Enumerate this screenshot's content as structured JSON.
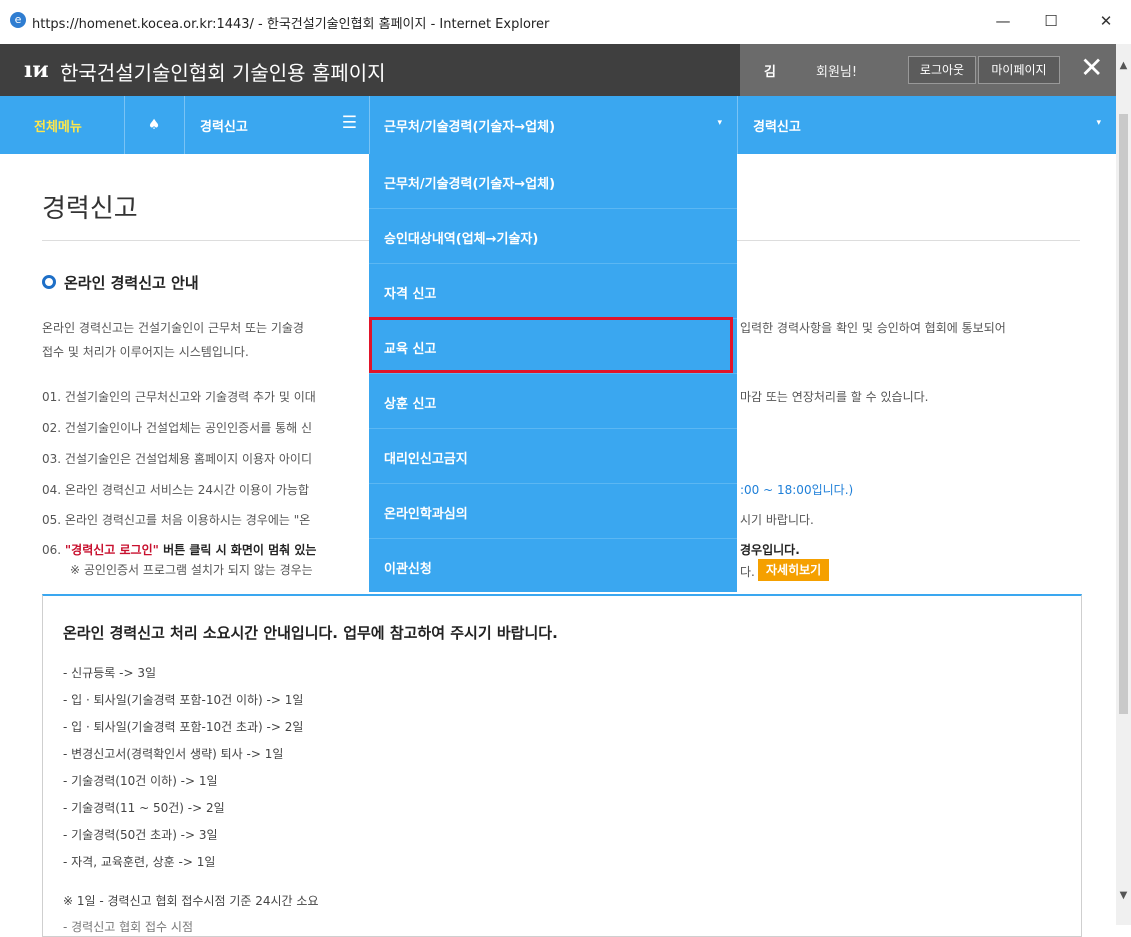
{
  "window": {
    "title": "https://homenet.kocea.or.kr:1443/ - 한국건설기술인협회 홈페이지 - Internet Explorer",
    "minimize": "—",
    "maximize": "☐",
    "close": "✕"
  },
  "header": {
    "logo": "ıᴎ",
    "title": "한국건설기술인협회 기술인용 홈페이지",
    "user_name": "김",
    "user_greeting": "회원님!",
    "logout": "로그아웃",
    "mypage": "마이페이지",
    "close": "✕"
  },
  "nav": {
    "all_menu": "전체메뉴",
    "home_icon": "♠",
    "item1": "경력신고",
    "item1_icon": "☰",
    "item2": "근무처/기술경력(기술자→업체)",
    "item3": "경력신고",
    "caret": "▾"
  },
  "dropdown": {
    "items": [
      {
        "label": "근무처/기술경력(기술자→업체)"
      },
      {
        "label": "승인대상내역(업체→기술자)"
      },
      {
        "label": "자격 신고"
      },
      {
        "label": "교육 신고"
      },
      {
        "label": "상훈 신고"
      },
      {
        "label": "대리인신고금지"
      },
      {
        "label": "온라인학과심의"
      },
      {
        "label": "이관신청"
      }
    ]
  },
  "page": {
    "title": "경력신고",
    "section_heading": "온라인 경력신고 안내",
    "intro_left": "온라인 경력신고는 건설기술인이 근무처 또는 기술경",
    "intro_right": "입력한 경력사항을 확인 및 승인하여 협회에 통보되어",
    "intro_line2": "접수 및 처리가 이루어지는 시스템입니다.",
    "item01_left": "01. 건설기술인의 근무처신고와 기술경력 추가 및 이대",
    "item01_right": "마감 또는 연장처리를 할 수 있습니다.",
    "item02_left": "02. 건설기술인이나 건설업체는 공인인증서를 통해 신",
    "item03_left": "03. 건설기술인은 건설업체용 홈페이지 이용자 아이디",
    "item04_left": "04. 온라인 경력신고 서비스는 24시간 이용이 가능합",
    "item04_right": ":00 ~ 18:00입니다.)",
    "item05_left": "05. 온라인 경력신고를 처음 이용하시는 경우에는 \"온",
    "item05_right": "시기 바랍니다.",
    "item06_num": "06.",
    "item06_red": "\"경력신고 로그인\"",
    "item06_rest": " 버튼 클릭 시 화면이 멈춰 있는",
    "item06_right": "경우입니다.",
    "item06_note": "※ 공인인증서 프로그램 설치가 되지 않는 경우는",
    "item06_note_right": "다.",
    "detail_button": "자세히보기"
  },
  "info_box": {
    "title": "온라인 경력신고 처리 소요시간 안내입니다. 업무에 참고하여 주시기 바랍니다.",
    "lines": [
      "- 신규등록 -> 3일",
      "- 입 · 퇴사일(기술경력 포함-10건 이하) -> 1일",
      "- 입 · 퇴사일(기술경력 포함-10건 초과) -> 2일",
      "- 변경신고서(경력확인서 생략) 퇴사 -> 1일",
      "- 기술경력(10건 이하) -> 1일",
      "- 기술경력(11 ~ 50건) -> 2일",
      "- 기술경력(50건 초과) -> 3일",
      "- 자격, 교육훈련, 상훈 -> 1일"
    ],
    "note": "※ 1일 - 경력신고 협회 접수시점 기준 24시간 소요",
    "note_cut": "    - 경력신고 협회 접수 시점"
  },
  "scrollbar": {
    "up": "▲",
    "down": "▼"
  }
}
